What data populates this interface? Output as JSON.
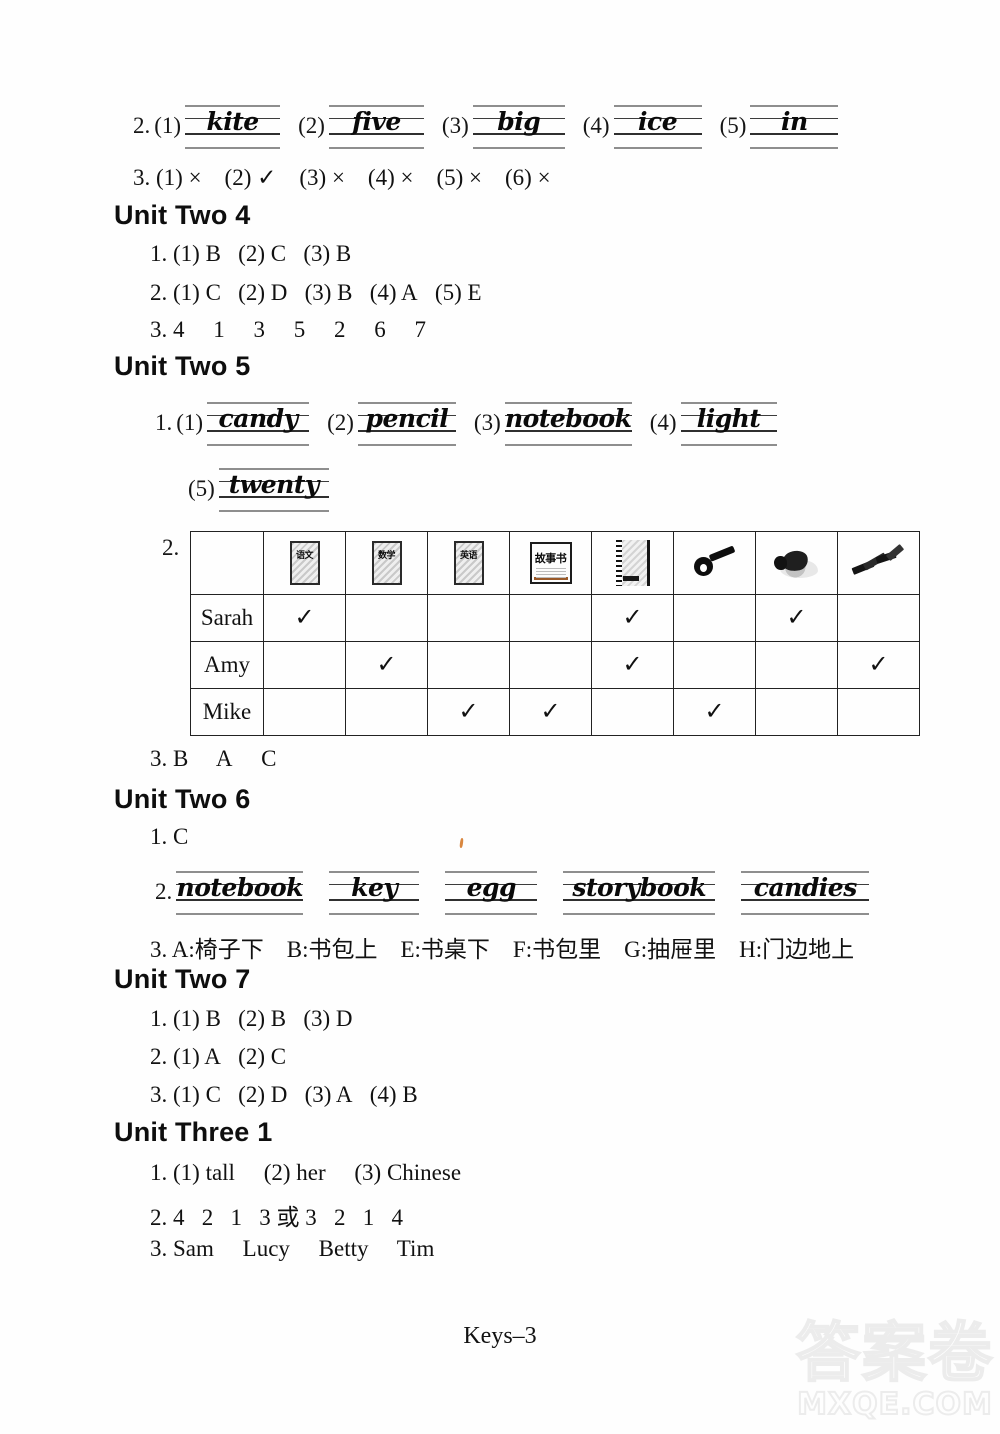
{
  "page": {
    "footer_label": "Keys–3",
    "watermark_cjk": "答案卷",
    "watermark_domain": "MXQE.COM"
  },
  "top_block": {
    "ex2": {
      "number": "2.",
      "items": [
        {
          "label": "(1)",
          "word": "kite"
        },
        {
          "label": "(2)",
          "word": "five"
        },
        {
          "label": "(3)",
          "word": "big"
        },
        {
          "label": "(4)",
          "word": "ice"
        },
        {
          "label": "(5)",
          "word": "in"
        }
      ]
    },
    "ex3": {
      "text": "3. (1) × (2) ✓ (3) × (4) × (5) × (6) ×"
    }
  },
  "unit_two_4": {
    "heading": "Unit Two 4",
    "lines": [
      "1. (1) B  (2) C  (3) B",
      "2. (1) C  (2) D  (3) B  (4) A  (5) E",
      "3. 4  1  3  5  2  6  7"
    ]
  },
  "unit_two_5": {
    "heading": "Unit Two 5",
    "ex1": {
      "number": "1.",
      "items_row1": [
        {
          "label": "(1)",
          "word": "candy"
        },
        {
          "label": "(2)",
          "word": "pencil"
        },
        {
          "label": "(3)",
          "word": "notebook"
        },
        {
          "label": "(4)",
          "word": "light"
        }
      ],
      "items_row2": [
        {
          "label": "(5)",
          "word": "twenty"
        }
      ]
    },
    "ex2": {
      "number": "2.",
      "table": {
        "column_icons": [
          {
            "icon": "chinese-textbook-icon",
            "label": "语文"
          },
          {
            "icon": "math-textbook-icon",
            "label": "数学"
          },
          {
            "icon": "english-textbook-icon",
            "label": "英语"
          },
          {
            "icon": "storybook-icon",
            "label": "故事书"
          },
          {
            "icon": "spiral-notebook-icon",
            "label": ""
          },
          {
            "icon": "key-icon",
            "label": ""
          },
          {
            "icon": "candy-icon",
            "label": ""
          },
          {
            "icon": "pencils-icon",
            "label": ""
          }
        ],
        "row_names": [
          "Sarah",
          "Amy",
          "Mike"
        ],
        "marks": [
          [
            true,
            false,
            false,
            false,
            true,
            false,
            true,
            false
          ],
          [
            false,
            true,
            false,
            false,
            true,
            false,
            false,
            true
          ],
          [
            false,
            false,
            true,
            true,
            false,
            true,
            false,
            false
          ]
        ],
        "tick_glyph": "✓"
      }
    },
    "ex3": {
      "text": "3. B  A  C"
    }
  },
  "unit_two_6": {
    "heading": "Unit Two 6",
    "ex1": {
      "text": "1. C"
    },
    "ex2": {
      "number": "2.",
      "words": [
        "notebook",
        "key",
        "egg",
        "storybook",
        "candies"
      ]
    },
    "ex3": {
      "text": "3. A:椅子下 B:书包上 E:书桌下 F:书包里 G:抽屉里 H:门边地上"
    }
  },
  "unit_two_7": {
    "heading": "Unit Two 7",
    "lines": [
      "1. (1) B  (2) B  (3) D",
      "2. (1) A  (2) C",
      "3. (1) C  (2) D  (3) A  (4) B"
    ]
  },
  "unit_three_1": {
    "heading": "Unit Three 1",
    "lines": [
      "1. (1) tall  (2) her  (3) Chinese",
      "2. 4  2  1  3 或 3  2  1  4",
      "3. Sam  Lucy  Betty  Tim"
    ]
  }
}
